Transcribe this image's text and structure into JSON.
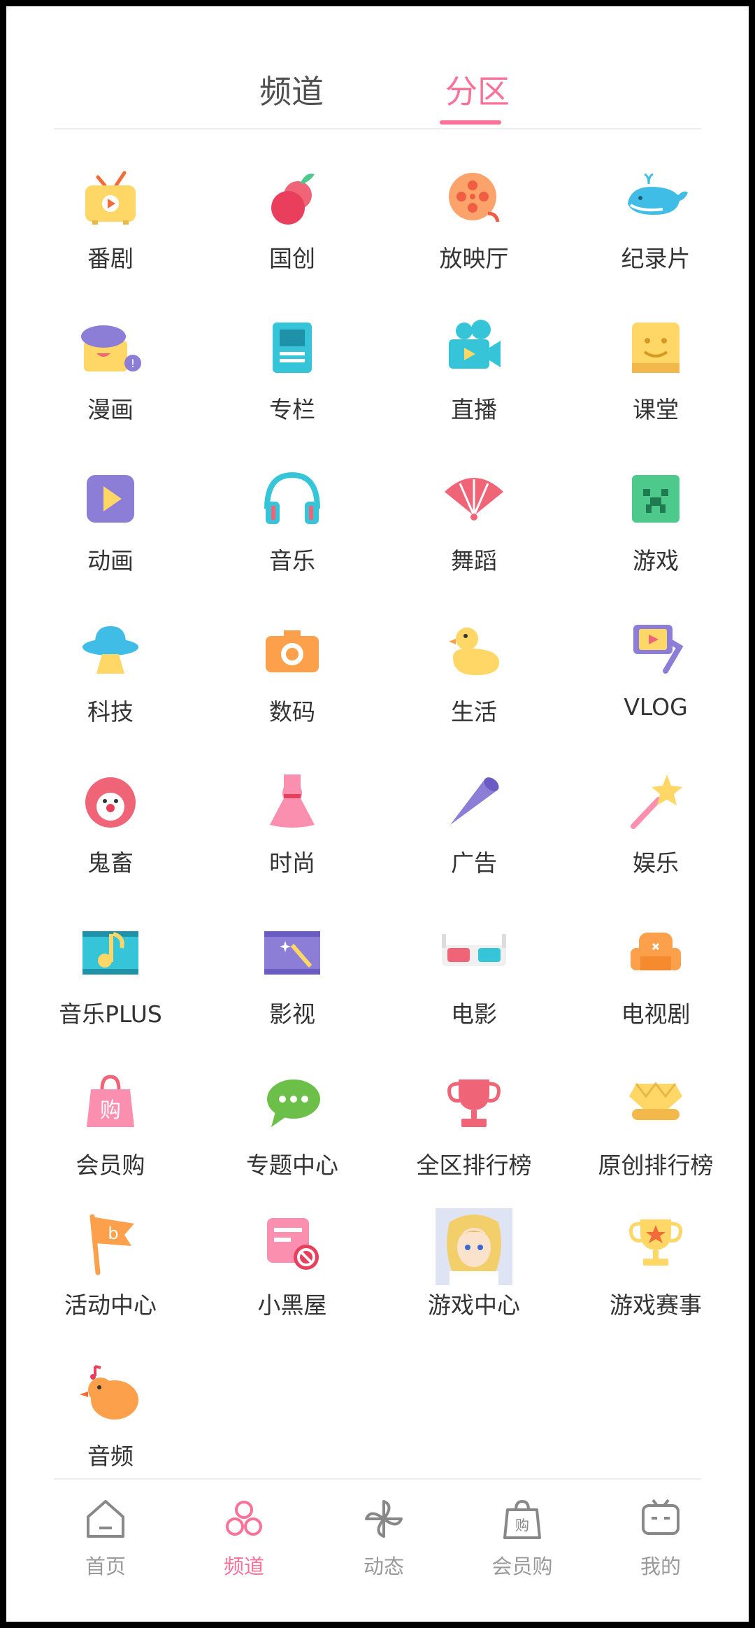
{
  "tabs": [
    {
      "label": "频道",
      "active": false
    },
    {
      "label": "分区",
      "active": true
    }
  ],
  "colors": {
    "accent": "#fb7299",
    "text": "#333333",
    "nav_inactive": "#9a9a9a"
  },
  "categories": [
    {
      "label": "番剧",
      "icon": "tv-icon"
    },
    {
      "label": "国创",
      "icon": "fruit-icon"
    },
    {
      "label": "放映厅",
      "icon": "film-reel-icon"
    },
    {
      "label": "纪录片",
      "icon": "whale-icon"
    },
    {
      "label": "漫画",
      "icon": "comic-icon"
    },
    {
      "label": "专栏",
      "icon": "article-icon"
    },
    {
      "label": "直播",
      "icon": "camera-video-icon"
    },
    {
      "label": "课堂",
      "icon": "classroom-icon"
    },
    {
      "label": "动画",
      "icon": "animation-play-icon"
    },
    {
      "label": "音乐",
      "icon": "headphones-icon"
    },
    {
      "label": "舞蹈",
      "icon": "fan-icon"
    },
    {
      "label": "游戏",
      "icon": "game-block-icon"
    },
    {
      "label": "科技",
      "icon": "ufo-icon"
    },
    {
      "label": "数码",
      "icon": "camera-icon"
    },
    {
      "label": "生活",
      "icon": "duck-icon"
    },
    {
      "label": "VLOG",
      "icon": "vlog-stabilizer-icon"
    },
    {
      "label": "鬼畜",
      "icon": "clown-icon"
    },
    {
      "label": "时尚",
      "icon": "dress-icon"
    },
    {
      "label": "广告",
      "icon": "megaphone-icon"
    },
    {
      "label": "娱乐",
      "icon": "star-wand-icon"
    },
    {
      "label": "音乐PLUS",
      "icon": "music-note-film-icon"
    },
    {
      "label": "影视",
      "icon": "film-magic-icon"
    },
    {
      "label": "电影",
      "icon": "3d-glasses-icon"
    },
    {
      "label": "电视剧",
      "icon": "sofa-icon"
    },
    {
      "label": "会员购",
      "icon": "shopping-bag-icon"
    },
    {
      "label": "专题中心",
      "icon": "chat-bubble-icon"
    },
    {
      "label": "全区排行榜",
      "icon": "trophy-cup-icon"
    },
    {
      "label": "原创排行榜",
      "icon": "original-crown-icon"
    },
    {
      "label": "活动中心",
      "icon": "flag-icon"
    },
    {
      "label": "小黑屋",
      "icon": "ban-card-icon"
    },
    {
      "label": "游戏中心",
      "icon": "anime-avatar-icon"
    },
    {
      "label": "游戏赛事",
      "icon": "star-trophy-icon"
    },
    {
      "label": "音频",
      "icon": "bird-icon"
    }
  ],
  "bottom_nav": [
    {
      "label": "首页",
      "icon": "home-icon",
      "active": false
    },
    {
      "label": "频道",
      "icon": "channel-icon",
      "active": true
    },
    {
      "label": "动态",
      "icon": "pinwheel-icon",
      "active": false
    },
    {
      "label": "会员购",
      "icon": "shopping-bag-icon",
      "active": false
    },
    {
      "label": "我的",
      "icon": "tv-face-icon",
      "active": false
    }
  ]
}
